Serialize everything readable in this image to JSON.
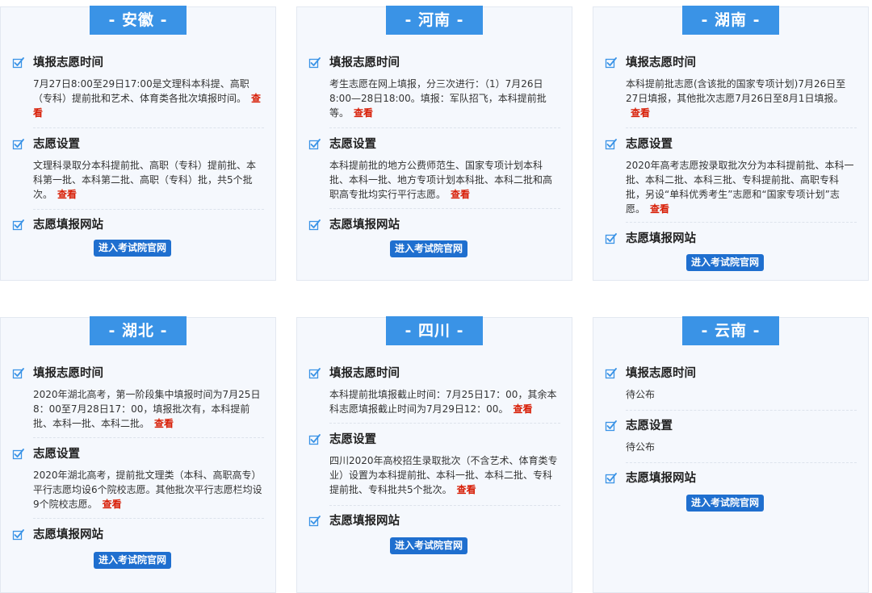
{
  "provinces": [
    {
      "title": "- 安徽 -",
      "time_title": "填报志愿时间",
      "time_text": "7月27日8:00至29日17:00是文理科本科提、高职（专科）提前批和艺术、体育类各批次填报时间。",
      "setting_title": "志愿设置",
      "setting_text": "文理科录取分本科提前批、高职（专科）提前批、本科第一批、本科第二批、高职（专科）批，共5个批次。",
      "site_title": "志愿填报网站",
      "button": "进入考试院官网",
      "view": "查看"
    },
    {
      "title": "- 河南 -",
      "time_title": "填报志愿时间",
      "time_text": "考生志愿在网上填报，分三次进行：（1）7月26日8:00—28日18:00。填报：军队招飞，本科提前批等。",
      "setting_title": "志愿设置",
      "setting_text": "本科提前批的地方公费师范生、国家专项计划本科批、本科一批、地方专项计划本科批、本科二批和高职高专批均实行平行志愿。",
      "site_title": "志愿填报网站",
      "button": "进入考试院官网",
      "view": "查看"
    },
    {
      "title": "- 湖南 -",
      "time_title": "填报志愿时间",
      "time_text": "本科提前批志愿(含该批的国家专项计划)7月26日至27日填报，其他批次志愿7月26日至8月1日填报。",
      "setting_title": "志愿设置",
      "setting_text": "2020年高考志愿按录取批次分为本科提前批、本科一批、本科二批、本科三批、专科提前批、高职专科批，另设“单科优秀考生”志愿和“国家专项计划”志愿。",
      "site_title": "志愿填报网站",
      "button": "进入考试院官网",
      "view": "查看"
    },
    {
      "title": "- 湖北 -",
      "time_title": "填报志愿时间",
      "time_text": "2020年湖北高考，第一阶段集中填报时间为7月25日8：00至7月28日17：00，填报批次有，本科提前批、本科一批、本科二批。",
      "setting_title": "志愿设置",
      "setting_text": "2020年湖北高考，提前批文理类（本科、高职高专）平行志愿均设6个院校志愿。其他批次平行志愿栏均设9个院校志愿。",
      "site_title": "志愿填报网站",
      "button": "进入考试院官网",
      "view": "查看"
    },
    {
      "title": "- 四川 -",
      "time_title": "填报志愿时间",
      "time_text": "本科提前批填报截止时间：7月25日17：00，其余本科志愿填报截止时间为7月29日12：00。",
      "setting_title": "志愿设置",
      "setting_text": "四川2020年高校招生录取批次（不含艺术、体育类专业）设置为本科提前批、本科一批、本科二批、专科提前批、专科批共5个批次。",
      "site_title": "志愿填报网站",
      "button": "进入考试院官网",
      "view": "查看"
    },
    {
      "title": "- 云南 -",
      "time_title": "填报志愿时间",
      "time_text": "待公布",
      "setting_title": "志愿设置",
      "setting_text": "待公布",
      "site_title": "志愿填报网站",
      "button": "进入考试院官网",
      "view": ""
    }
  ],
  "colors": {
    "accent": "#3a93e6",
    "button": "#1f6fcf",
    "link": "#d81e06",
    "card_bg": "#f5f8fd"
  },
  "icons": {
    "section_marker": "checkbox-checked-icon"
  }
}
